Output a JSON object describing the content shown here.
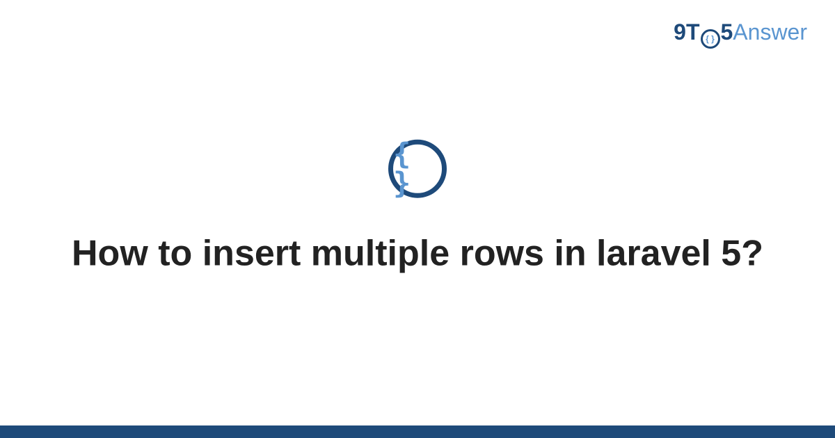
{
  "logo": {
    "part1": "9T",
    "o_inner": "{ }",
    "part2": "5",
    "part3": "Answer"
  },
  "icon": {
    "name": "code-braces-icon",
    "glyph": "{ }"
  },
  "title": "How to insert multiple rows in laravel 5?",
  "colors": {
    "primary": "#1e4a7a",
    "accent": "#5a95d0"
  }
}
